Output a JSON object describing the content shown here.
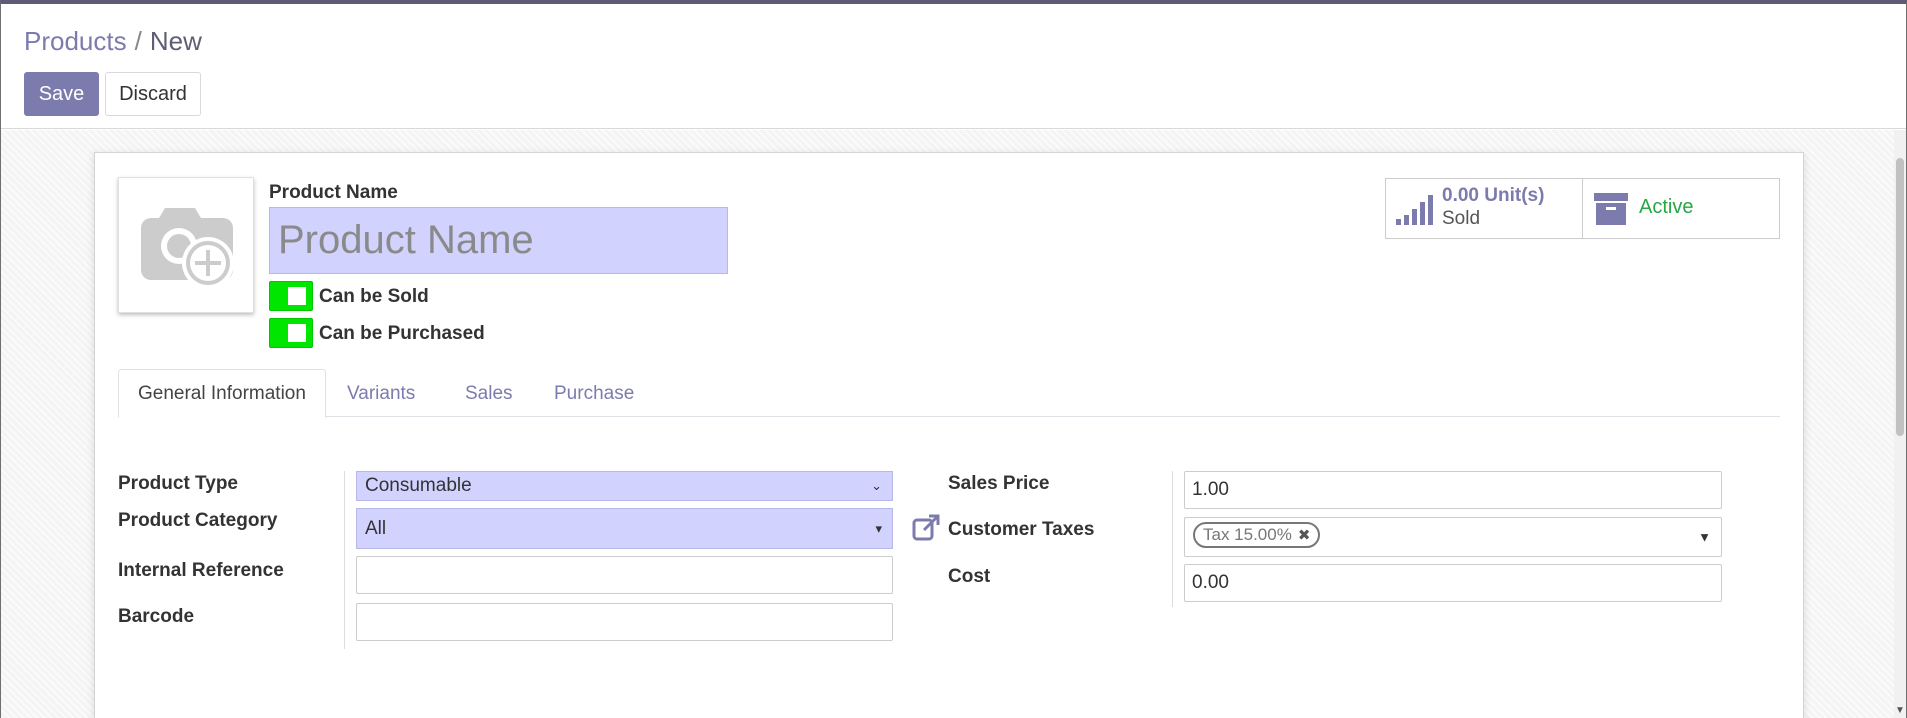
{
  "breadcrumb": {
    "parent": "Products",
    "separator": "/",
    "current": "New"
  },
  "toolbar": {
    "save_label": "Save",
    "discard_label": "Discard"
  },
  "form": {
    "name_label": "Product Name",
    "name_placeholder": "Product Name",
    "can_be_sold_label": "Can be Sold",
    "can_be_sold": true,
    "can_be_purchased_label": "Can be Purchased",
    "can_be_purchased": true
  },
  "smart_buttons": {
    "sold_value": "0.00 Unit(s)",
    "sold_label": "Sold",
    "active_label": "Active"
  },
  "tabs": [
    {
      "label": "General Information",
      "active": true
    },
    {
      "label": "Variants",
      "active": false
    },
    {
      "label": "Sales",
      "active": false
    },
    {
      "label": "Purchase",
      "active": false
    }
  ],
  "general": {
    "product_type_label": "Product Type",
    "product_type_value": "Consumable",
    "product_category_label": "Product Category",
    "product_category_value": "All",
    "internal_reference_label": "Internal Reference",
    "internal_reference_value": "",
    "barcode_label": "Barcode",
    "barcode_value": "",
    "sales_price_label": "Sales Price",
    "sales_price_value": "1.00",
    "customer_taxes_label": "Customer Taxes",
    "customer_taxes_tags": [
      "Tax 15.00%"
    ],
    "cost_label": "Cost",
    "cost_value": "0.00"
  },
  "colors": {
    "accent": "#7c7bad",
    "toggle_on": "#00e600",
    "highlight_field": "#d2d2ff",
    "active_green": "#28a745"
  },
  "icons": {
    "image_placeholder": "camera-plus-icon",
    "sold": "signal-bars-icon",
    "active": "archive-box-icon",
    "external_link": "external-link-icon",
    "dropdown": "caret-down-icon"
  }
}
